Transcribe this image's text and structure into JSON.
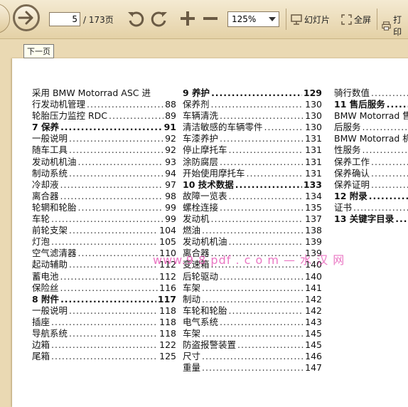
{
  "toolbar": {
    "current_page": "5",
    "total_pages": "/ 173页",
    "zoom": "125%",
    "slideshow_label": "幻灯片",
    "fullscreen_label": "全屏",
    "print_label": "打印"
  },
  "tooltip": "下一页",
  "watermark": "www.9 8 pdf . c o m  — 水 汉 网",
  "toc": {
    "col1": [
      {
        "text": "采用 BMW Motorrad ASC 进",
        "page": "",
        "type": "nd"
      },
      {
        "text": "行发动机管理",
        "page": "88",
        "type": ""
      },
      {
        "text": "轮胎压力监控 RDC",
        "page": "89",
        "type": ""
      },
      {
        "text": "7 保养",
        "page": "91",
        "type": "h"
      },
      {
        "text": "一般说明",
        "page": "92",
        "type": ""
      },
      {
        "text": "随车工具",
        "page": "92",
        "type": ""
      },
      {
        "text": "发动机机油",
        "page": "93",
        "type": ""
      },
      {
        "text": "制动系统",
        "page": "94",
        "type": ""
      },
      {
        "text": "冷却液",
        "page": "97",
        "type": ""
      },
      {
        "text": "离合器",
        "page": "98",
        "type": ""
      },
      {
        "text": "轮辋和轮胎",
        "page": "99",
        "type": ""
      },
      {
        "text": "车轮",
        "page": "99",
        "type": ""
      },
      {
        "text": "前轮支架",
        "page": "104",
        "type": ""
      },
      {
        "text": "灯泡",
        "page": "105",
        "type": ""
      },
      {
        "text": "空气滤清器",
        "page": "110",
        "type": ""
      },
      {
        "text": "起动辅助",
        "page": "112",
        "type": ""
      },
      {
        "text": "蓄电池",
        "page": "112",
        "type": ""
      },
      {
        "text": "保险丝",
        "page": "116",
        "type": ""
      },
      {
        "text": "8 附件",
        "page": "117",
        "type": "h"
      },
      {
        "text": "一般说明",
        "page": "118",
        "type": ""
      },
      {
        "text": "插座",
        "page": "118",
        "type": ""
      },
      {
        "text": "导航系统",
        "page": "118",
        "type": ""
      },
      {
        "text": "边箱",
        "page": "122",
        "type": ""
      },
      {
        "text": "尾箱",
        "page": "125",
        "type": ""
      }
    ],
    "col2": [
      {
        "text": "9 养护",
        "page": "129",
        "type": "h"
      },
      {
        "text": "保养剂",
        "page": "130",
        "type": ""
      },
      {
        "text": "车辆清洗",
        "page": "130",
        "type": ""
      },
      {
        "text": "清洁敏感的车辆零件",
        "page": "130",
        "type": ""
      },
      {
        "text": "车漆养护",
        "page": "131",
        "type": ""
      },
      {
        "text": "停止摩托车",
        "page": "131",
        "type": ""
      },
      {
        "text": "涂防腐层",
        "page": "131",
        "type": ""
      },
      {
        "text": "开始使用摩托车",
        "page": "131",
        "type": ""
      },
      {
        "text": "10 技术数据",
        "page": "133",
        "type": "h"
      },
      {
        "text": "故障一览表",
        "page": "134",
        "type": ""
      },
      {
        "text": "螺栓连接",
        "page": "135",
        "type": ""
      },
      {
        "text": "发动机",
        "page": "137",
        "type": ""
      },
      {
        "text": "燃油",
        "page": "138",
        "type": ""
      },
      {
        "text": "发动机机油",
        "page": "139",
        "type": ""
      },
      {
        "text": "离合器",
        "page": "139",
        "type": ""
      },
      {
        "text": "变速箱",
        "page": "140",
        "type": ""
      },
      {
        "text": "后轮驱动",
        "page": "140",
        "type": ""
      },
      {
        "text": "车架",
        "page": "141",
        "type": ""
      },
      {
        "text": "制动",
        "page": "142",
        "type": ""
      },
      {
        "text": "车轮和轮胎",
        "page": "142",
        "type": ""
      },
      {
        "text": "电气系统",
        "page": "143",
        "type": ""
      },
      {
        "text": "车架",
        "page": "145",
        "type": ""
      },
      {
        "text": "防盗报警装置",
        "page": "145",
        "type": ""
      },
      {
        "text": "尺寸",
        "page": "146",
        "type": ""
      },
      {
        "text": "重量",
        "page": "147",
        "type": ""
      }
    ],
    "col3": [
      {
        "text": "骑行数值",
        "page": "",
        "type": ""
      },
      {
        "text": "11 售后服务",
        "page": "",
        "type": "h"
      },
      {
        "text": "BMW Motorrad 售",
        "page": "",
        "type": "nd"
      },
      {
        "text": "后服务",
        "page": "",
        "type": ""
      },
      {
        "text": "BMW Motorrad 机",
        "page": "",
        "type": "nd"
      },
      {
        "text": "性服务",
        "page": "",
        "type": ""
      },
      {
        "text": "保养工作",
        "page": "",
        "type": ""
      },
      {
        "text": "保养确认",
        "page": "",
        "type": ""
      },
      {
        "text": "保养证明",
        "page": "",
        "type": ""
      },
      {
        "text": "12 附录",
        "page": "",
        "type": "h"
      },
      {
        "text": "证书",
        "page": "",
        "type": ""
      },
      {
        "text": "13 关键字目录",
        "page": "",
        "type": "h"
      }
    ]
  }
}
